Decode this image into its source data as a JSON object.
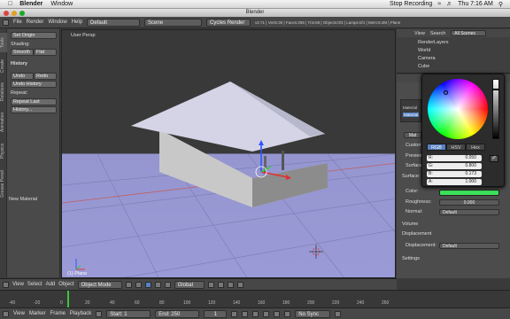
{
  "macbar": {
    "app": "Blender",
    "menu_window": "Window",
    "recording": "Stop Recording",
    "time": "Thu 7:16 AM",
    "apple": ""
  },
  "window_title": "Blender",
  "info_header": {
    "menus": [
      "File",
      "Render",
      "Window",
      "Help"
    ],
    "layout": "Default",
    "scene": "Scene",
    "engine": "Cycles Render",
    "stats": "v2.71 | Verts:30 | Faces:296 | Tris:58 | Objects:0/3 | Lamps:0/1 | Mem:8.3M | Plane"
  },
  "tool_tabs": [
    "Tools",
    "Create",
    "Relations",
    "Animation",
    "Physics",
    "Grease Pencil"
  ],
  "tool_shelf": {
    "set_origin": "Set Origin",
    "shading_label": "Shading:",
    "smooth": "Smooth",
    "flat": "Flat",
    "history_label": "History",
    "undo": "Undo",
    "redo": "Redo",
    "undo_history": "Undo History",
    "repeat_label": "Repeat:",
    "repeat_last": "Repeat Last",
    "history_btn": "History...",
    "new_material": "New Material"
  },
  "viewport": {
    "label": "User Persp",
    "object": "(1) Plane"
  },
  "outliner": {
    "view": "View",
    "search": "Search",
    "filter": "All Scenes",
    "items": [
      "RenderLayers",
      "World",
      "Camera",
      "Cube"
    ]
  },
  "props": {
    "material_slots": [
      "Material",
      "Material"
    ],
    "surface_btn": "Mat",
    "sections": [
      "Custom",
      "Preview",
      "Surface",
      "Volume",
      "Displacement",
      "Settings"
    ],
    "surface_label": "Surface:",
    "color_label": "Color:",
    "roughness_label": "Roughness:",
    "roughness_value": "0.000",
    "normal_label": "Normal:",
    "normal_value": "Default",
    "displacement_label": "Displacement:",
    "displacement_value": "Default"
  },
  "picker": {
    "tabs": [
      "RGB",
      "HSV",
      "Hex"
    ],
    "r": "R:",
    "r_val": "0.050",
    "g": "G:",
    "g_val": "0.800",
    "b": "B:",
    "b_val": "0.173",
    "a": "A:",
    "a_val": "1.000",
    "swatch_color": "#3ce05a"
  },
  "viewport_header": {
    "menus": [
      "View",
      "Select",
      "Add",
      "Object"
    ],
    "mode": "Object Mode",
    "orientation": "Global"
  },
  "timeline": {
    "ticks": [
      "-40",
      "-20",
      "0",
      "20",
      "40",
      "60",
      "80",
      "100",
      "120",
      "140",
      "160",
      "180",
      "200",
      "220",
      "240",
      "260"
    ]
  },
  "timeline_header": {
    "menus": [
      "View",
      "Marker",
      "Frame",
      "Playback"
    ],
    "start_label": "Start:",
    "start_val": "1",
    "end_label": "End:",
    "end_val": "250",
    "current": "1",
    "sync": "No Sync"
  }
}
